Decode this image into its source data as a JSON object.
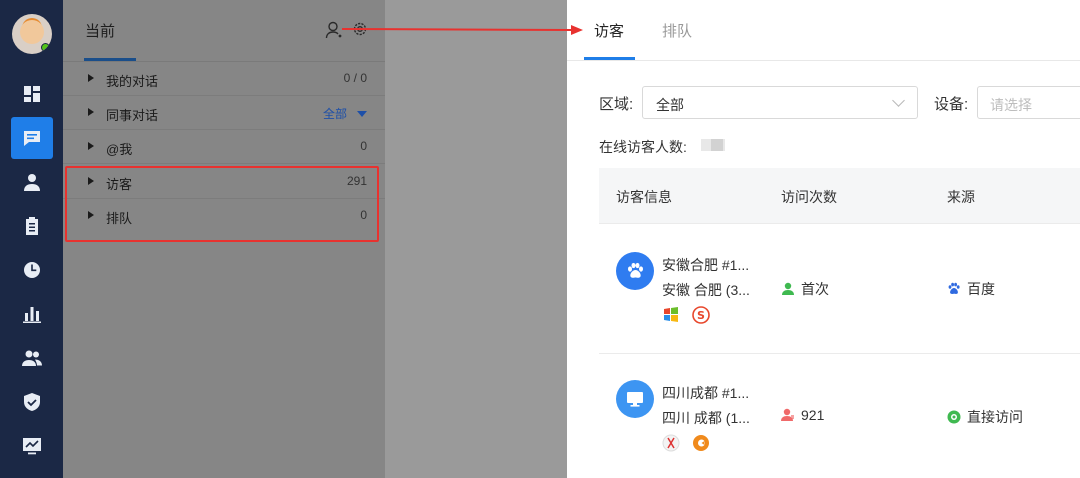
{
  "rail": {
    "items": [
      "dashboard",
      "chat",
      "user",
      "clipboard",
      "clock",
      "bar-chart",
      "team",
      "shield",
      "monitor-chart"
    ],
    "active": 1
  },
  "list_panel": {
    "tab_current": "当前",
    "rows": [
      {
        "label": "我的对话",
        "count": "0 / 0"
      },
      {
        "label": "同事对话",
        "count": "全部"
      },
      {
        "label": "@我",
        "count": "0"
      },
      {
        "label": "访客",
        "count": "291"
      },
      {
        "label": "排队",
        "count": "0"
      }
    ]
  },
  "drawer": {
    "tabs": [
      "访客",
      "排队"
    ],
    "region_label": "区域:",
    "region_value": "全部",
    "device_label": "设备:",
    "device_placeholder": "请选择",
    "online_label": "在线访客人数:",
    "columns": [
      "访客信息",
      "访问次数",
      "来源"
    ],
    "visitors": [
      {
        "line1": "安徽合肥 #1...",
        "line2": "安徽 合肥 (3...",
        "visits": "首次",
        "source": "百度"
      },
      {
        "line1": "四川成都 #1...",
        "line2": "四川 成都 (1...",
        "visits": "921",
        "source": "直接访问"
      }
    ]
  },
  "colors": {
    "rail_bg": "#1b2845",
    "accent": "#1f7ee8",
    "highlight": "#e8322f"
  }
}
